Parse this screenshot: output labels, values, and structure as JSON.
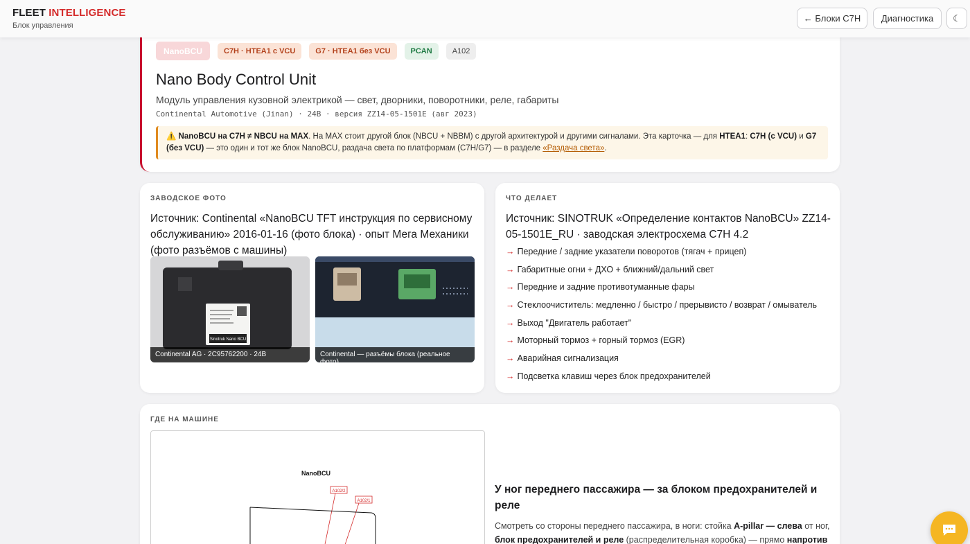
{
  "header": {
    "brand_part1": "FLEET",
    "brand_part2": "INTELLIGENCE",
    "subtitle": "Блок управления",
    "back_button": "← Блоки C7H",
    "diag_button": "Диагностика",
    "theme_icon": "☾"
  },
  "hero": {
    "tags": [
      "NanoBCU",
      "C7H · HTEA1 с VCU",
      "G7 · HTEA1 без VCU",
      "PCAN",
      "A102"
    ],
    "title": "Nano Body Control Unit",
    "subtitle": "Модуль управления кузовной электрикой — свет, дворники, поворотники, реле, габариты",
    "meta": "Continental Automotive (Jinan) · 24В · версия ZZ14-05-1501E (авг 2023)",
    "warning": {
      "icon": "⚠️",
      "bold1": "NanoBCU на C7H ≠ NBCU на MAX",
      "text1": ". На MAX стоит другой блок (NBCU + NBBM) с другой архитектурой и другими сигналами. Эта карточка — для ",
      "bold2": "HTEA1",
      "text2": ": ",
      "bold3": "C7H (с VCU)",
      "text3": " и ",
      "bold4": "G7 (без VCU)",
      "text4": " — это один и тот же блок NanoBCU, раздача света по платформам (C7H/G7) — в разделе ",
      "link": "«Раздача света»",
      "text5": "."
    }
  },
  "photo": {
    "label": "ЗАВОДСКОЕ ФОТО",
    "source": "Источник: Continental «NanoBCU TFT инструкция по сервисному обслуживанию» 2016-01-16 (фото блока) · опыт Мега Механики (фото разъёмов с машины)",
    "sticker_text": "Sinotruk Nano BCU",
    "caption1": "Continental AG · 2C95762200 · 24B",
    "caption2": "Continental — разъёмы блока (реальное фото)"
  },
  "does": {
    "label": "ЧТО ДЕЛАЕТ",
    "source": "Источник: SINOTRUK «Определение контактов NanoBCU» ZZ14-05-1501E_RU · заводская электросхема C7H 4.2",
    "arrow": "→",
    "items": [
      "Передние / задние указатели поворотов (тягач + прицеп)",
      "Габаритные огни + ДХО + ближний/дальний свет",
      "Передние и задние противотуманные фары",
      "Стеклоочиститель: медленно / быстро / прерывисто / возврат / омыватель",
      "Выход \"Двигатель работает\"",
      "Моторный тормоз + горный тормоз (EGR)",
      "Аварийная сигнализация",
      "Подсветка клавиш через блок предохранителей"
    ]
  },
  "where": {
    "label": "ГДЕ НА МАШИНЕ",
    "diagram_title": "NanoBCU",
    "diagram_pin1": "A102/2",
    "diagram_pin2": "A102/1",
    "title": "У ног переднего пассажира — за блоком предохранителей и реле",
    "text1": "Смотреть со стороны переднего пассажира, в ноги: стойка ",
    "bold1": "A-pillar — слева",
    "text2": " от ног, ",
    "bold2": "блок предохранителей и реле",
    "text3": " (распределительная коробка) — прямо ",
    "bold3": "напротив"
  }
}
